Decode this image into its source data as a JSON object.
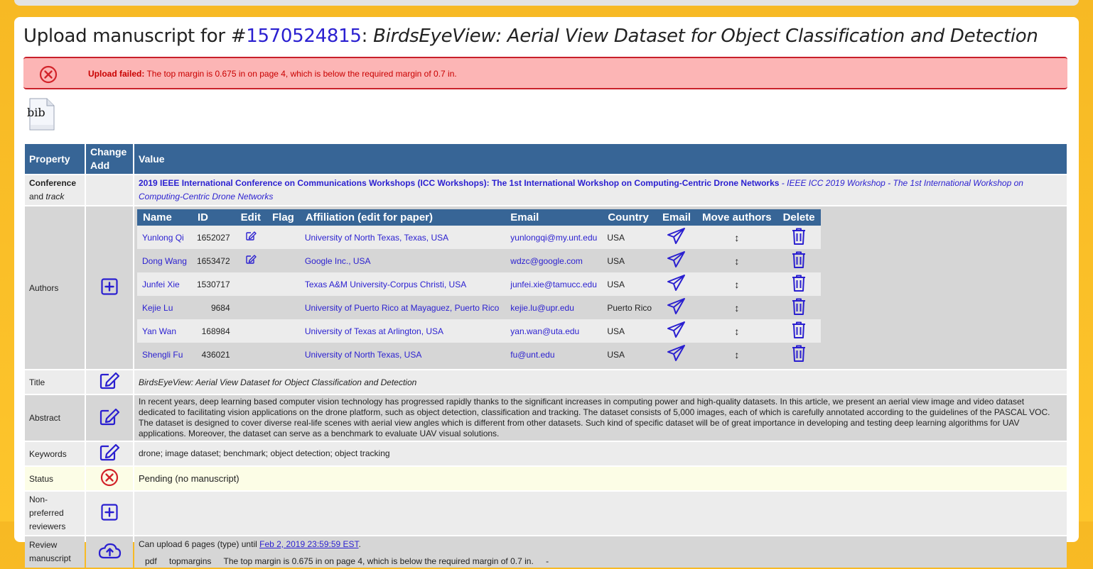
{
  "page": {
    "heading_prefix": "Upload manuscript for #",
    "paper_id": "1570524815",
    "heading_sep": ": ",
    "paper_title": "BirdsEyeView: Aerial View Dataset for Object Classification and Detection"
  },
  "alert": {
    "label": "Upload failed:",
    "message": " The top margin is 0.675 in on page 4, which is below the required margin of 0.7 in."
  },
  "bib_icon_text": "bib",
  "table_headers": {
    "property": "Property",
    "change": "Change",
    "add": "Add",
    "value": "Value"
  },
  "conference": {
    "label_bold": "Conference",
    "label_and": " and ",
    "label_track": "track",
    "name": "2019 IEEE International Conference on Communications Workshops (ICC Workshops): The 1st International Workshop on Computing-Centric Drone Networks",
    "track": " - IEEE ICC 2019 Workshop - The 1st International Workshop on Computing-Centric Drone Networks"
  },
  "authors": {
    "label": "Authors",
    "headers": [
      "Name",
      "ID",
      "Edit",
      "Flag",
      "Affiliation (edit for paper)",
      "Email",
      "Country",
      "Email",
      "Move authors",
      "Delete"
    ],
    "rows": [
      {
        "name": "Yunlong Qi",
        "id": "1652027",
        "editable": true,
        "affiliation": "University of North Texas, Texas, USA",
        "email": "yunlongqi@my.unt.edu",
        "country": "USA"
      },
      {
        "name": "Dong Wang",
        "id": "1653472",
        "editable": true,
        "affiliation": "Google Inc., USA",
        "email": "wdzc@google.com",
        "country": "USA"
      },
      {
        "name": "Junfei Xie",
        "id": "1530717",
        "editable": false,
        "affiliation": "Texas A&M University-Corpus Christi, USA",
        "email": "junfei.xie@tamucc.edu",
        "country": "USA"
      },
      {
        "name": "Kejie Lu",
        "id": "9684",
        "editable": false,
        "affiliation": "University of Puerto Rico at Mayaguez, Puerto Rico",
        "email": "kejie.lu@upr.edu",
        "country": "Puerto Rico"
      },
      {
        "name": "Yan Wan",
        "id": "168984",
        "editable": false,
        "affiliation": "University of Texas at Arlington, USA",
        "email": "yan.wan@uta.edu",
        "country": "USA"
      },
      {
        "name": "Shengli Fu",
        "id": "436021",
        "editable": false,
        "affiliation": "University of North Texas, USA",
        "email": "fu@unt.edu",
        "country": "USA"
      }
    ],
    "move_glyph": "↕"
  },
  "title_row": {
    "label": "Title",
    "value": "BirdsEyeView: Aerial View Dataset for Object Classification and Detection"
  },
  "abstract_row": {
    "label": "Abstract",
    "value": "In recent years, deep learning based computer vision technology has progressed rapidly thanks to the significant increases in computing power and high-quality datasets. In this article, we present an aerial view image and video dataset dedicated to facilitating vision applications on the drone platform, such as object detection, classification and tracking. The dataset consists of 5,000 images, each of which is carefully annotated according to the guidelines of the PASCAL VOC. The dataset is designed to cover diverse real-life scenes with aerial view angles which is different from other datasets. Such kind of specific dataset will be of great importance in developing and testing deep learning algorithms for UAV applications. Moreover, the dataset can serve as a benchmark to evaluate UAV visual solutions."
  },
  "keywords_row": {
    "label": "Keywords",
    "value": "drone; image dataset; benchmark; object detection; object tracking"
  },
  "status_row": {
    "label": "Status",
    "value": "Pending (no manuscript)"
  },
  "reviewers_row": {
    "label_1": "Non-",
    "label_2": "preferred",
    "label_3": "reviewers"
  },
  "review_row": {
    "label_1": "Review",
    "label_2": "manuscript",
    "upload_text": "Can upload 6 pages (type) until ",
    "deadline": "Feb 2, 2019 23:59:59 EST",
    "upload_end": ".",
    "err_type": "pdf",
    "err_code": "topmargins",
    "err_msg": "The top margin is 0.675 in on page 4, which is below the required margin of 0.7 in.",
    "err_dash": "-"
  },
  "colors": {
    "accent": "#2a1fd0",
    "header_bg": "#376596",
    "alert_bg": "#fcb5b5",
    "alert_text": "#c90000",
    "status_icon": "#d2232a"
  }
}
